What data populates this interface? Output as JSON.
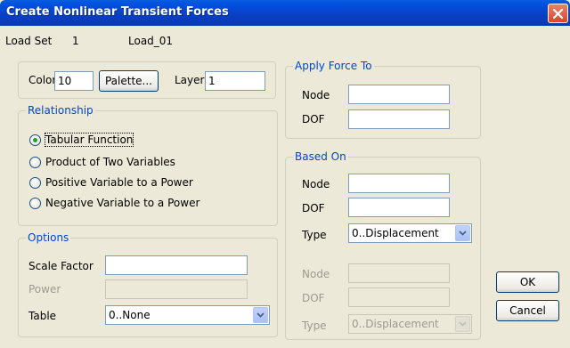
{
  "window": {
    "title": "Create Nonlinear Transient Forces"
  },
  "load_set": {
    "label": "Load Set",
    "number": "1",
    "name": "Load_01"
  },
  "display": {
    "color_label": "Color",
    "color_value": "10",
    "palette_button": "Palette...",
    "layer_label": "Layer",
    "layer_value": "1"
  },
  "relationship": {
    "legend": "Relationship",
    "options": [
      {
        "label": "Tabular Function",
        "selected": true
      },
      {
        "label": "Product of Two Variables",
        "selected": false
      },
      {
        "label": "Positive Variable to a Power",
        "selected": false
      },
      {
        "label": "Negative Variable to a Power",
        "selected": false
      }
    ]
  },
  "options": {
    "legend": "Options",
    "scale_factor_label": "Scale Factor",
    "scale_factor_value": "",
    "power_label": "Power",
    "power_value": "",
    "table_label": "Table",
    "table_value": "0..None"
  },
  "apply_force_to": {
    "legend": "Apply Force To",
    "node_label": "Node",
    "node_value": "",
    "dof_label": "DOF",
    "dof_value": ""
  },
  "based_on": {
    "legend": "Based On",
    "node_label": "Node",
    "node_value": "",
    "dof_label": "DOF",
    "dof_value": "",
    "type_label": "Type",
    "type_value": "0..Displacement",
    "node2_label": "Node",
    "node2_value": "",
    "dof2_label": "DOF",
    "dof2_value": "",
    "type2_label": "Type",
    "type2_value": "0..Displacement"
  },
  "buttons": {
    "ok": "OK",
    "cancel": "Cancel"
  },
  "colors": {
    "titlebar": "#0a3fc4",
    "dialog_bg": "#ece9d8",
    "group_label": "#0046d5",
    "radio_selected": "#21a121"
  }
}
